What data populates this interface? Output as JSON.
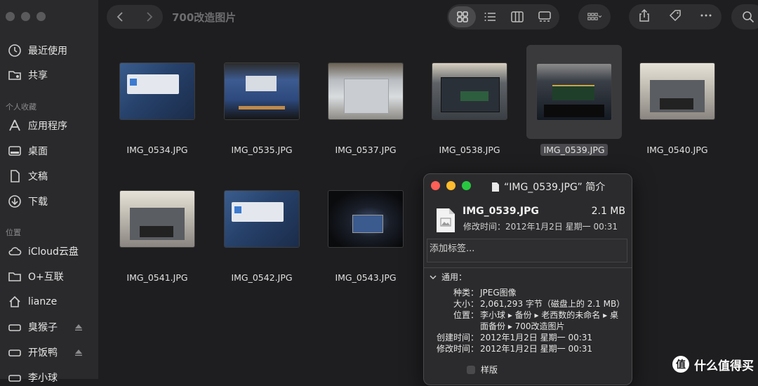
{
  "window": {
    "title": "700改造图片"
  },
  "sidebar": {
    "items_top": [
      {
        "label": "最近使用",
        "icon": "clock-icon"
      },
      {
        "label": "共享",
        "icon": "shared-folder-icon"
      }
    ],
    "section_favorites": "个人收藏",
    "favorites": [
      {
        "label": "应用程序",
        "icon": "applications-icon"
      },
      {
        "label": "桌面",
        "icon": "desktop-icon"
      },
      {
        "label": "文稿",
        "icon": "document-icon"
      },
      {
        "label": "下载",
        "icon": "download-icon"
      }
    ],
    "section_locations": "位置",
    "locations": [
      {
        "label": "iCloud云盘",
        "icon": "cloud-icon"
      },
      {
        "label": "O+互联",
        "icon": "folder-icon"
      },
      {
        "label": "lianze",
        "icon": "home-icon"
      },
      {
        "label": "臭猴子",
        "icon": "drive-icon",
        "ejectable": true
      },
      {
        "label": "开饭鸭",
        "icon": "drive-icon",
        "ejectable": true
      },
      {
        "label": "李小球",
        "icon": "drive-icon"
      }
    ]
  },
  "files": [
    {
      "name": "IMG_0534.JPG",
      "thumb": "screen",
      "selected": false
    },
    {
      "name": "IMG_0535.JPG",
      "thumb": "mac",
      "selected": false
    },
    {
      "name": "IMG_0537.JPG",
      "thumb": "bottom",
      "selected": false
    },
    {
      "name": "IMG_0538.JPG",
      "thumb": "open",
      "selected": false
    },
    {
      "name": "IMG_0539.JPG",
      "thumb": "dark",
      "selected": true
    },
    {
      "name": "IMG_0540.JPG",
      "thumb": "light",
      "selected": false
    },
    {
      "name": "IMG_0541.JPG",
      "thumb": "light",
      "selected": false
    },
    {
      "name": "IMG_0542.JPG",
      "thumb": "screen",
      "selected": false
    },
    {
      "name": "IMG_0543.JPG",
      "thumb": "night",
      "selected": false
    }
  ],
  "info": {
    "title": "“IMG_0539.JPG” 简介",
    "filename": "IMG_0539.JPG",
    "size_short": "2.1 MB",
    "modified": "修改时间：2012年1月2日 星期一 00:31",
    "tags_placeholder": "添加标签...",
    "general": "通用：",
    "rows": [
      {
        "k": "种类：",
        "v": "JPEG图像"
      },
      {
        "k": "大小：",
        "v": "2,061,293 字节（磁盘上的 2.1 MB）"
      },
      {
        "k": "位置：",
        "v": "李小球 ▸ 备份 ▸ 老西数的未命名 ▸ 桌面备份 ▸ 700改造图片"
      },
      {
        "k": "创建时间：",
        "v": "2012年1月2日 星期一 00:31"
      },
      {
        "k": "修改时间：",
        "v": "2012年1月2日 星期一 00:31"
      }
    ],
    "stationery_label": "样版"
  },
  "watermark": {
    "text": "什么值得买"
  },
  "colors": {
    "close": "#fe5f57",
    "minimize": "#febc2e",
    "zoom": "#28c840"
  }
}
